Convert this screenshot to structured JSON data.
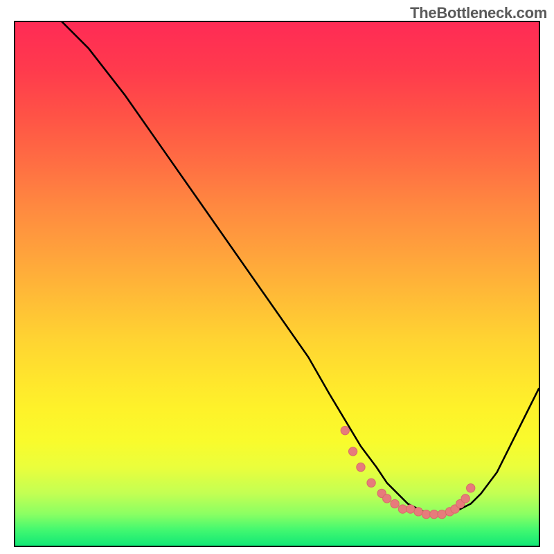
{
  "watermark": "TheBottleneck.com",
  "colors": {
    "curve_stroke": "#000000",
    "marker_fill": "#e77b7b",
    "marker_stroke": "#d76a6a"
  },
  "chart_data": {
    "type": "line",
    "title": "",
    "xlabel": "",
    "ylabel": "",
    "xlim": [
      0,
      100
    ],
    "ylim": [
      0,
      100
    ],
    "grid": false,
    "series": [
      {
        "name": "curve",
        "x": [
          0,
          4,
          9,
          14,
          21,
          28,
          35,
          42,
          49,
          56,
          60,
          63,
          66,
          69,
          71,
          73,
          75,
          77,
          79,
          81,
          83,
          85,
          87,
          89,
          92,
          95,
          100
        ],
        "y": [
          110,
          105,
          100,
          95,
          86,
          76,
          66,
          56,
          46,
          36,
          29,
          24,
          19,
          15,
          12,
          10,
          8,
          7,
          6,
          6,
          6,
          7,
          8,
          10,
          14,
          20,
          30
        ]
      }
    ],
    "markers": {
      "name": "highlight-points",
      "x": [
        63,
        64.5,
        66,
        68,
        70,
        71,
        72.5,
        74,
        75.5,
        77,
        78.5,
        80,
        81.5,
        83,
        84,
        85,
        86,
        87
      ],
      "y": [
        22,
        18,
        15,
        12,
        10,
        9,
        8,
        7,
        7,
        6.5,
        6,
        6,
        6,
        6.5,
        7,
        8,
        9,
        11
      ]
    }
  }
}
